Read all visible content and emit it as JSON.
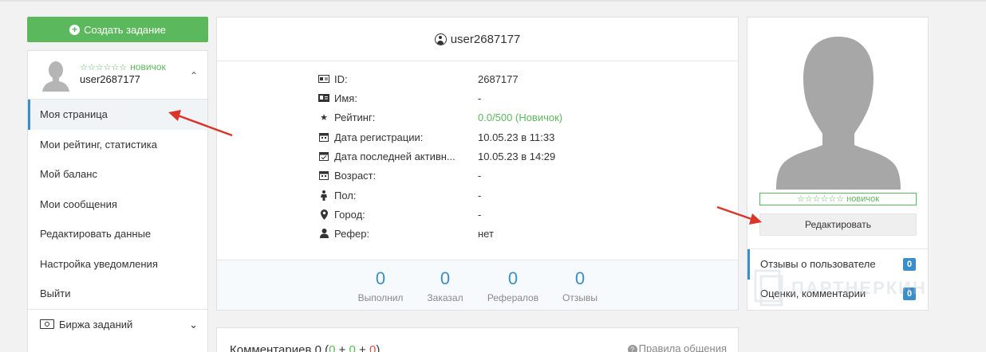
{
  "sidebar": {
    "create_button": "Создать задание",
    "user": {
      "stars": "☆☆☆☆☆☆",
      "rank": "новичок",
      "username": "user2687177"
    },
    "menu": [
      {
        "label": "Моя страница",
        "active": true
      },
      {
        "label": "Мои рейтинг, статистика"
      },
      {
        "label": "Мой баланс"
      },
      {
        "label": "Мои сообщения"
      },
      {
        "label": "Редактировать данные"
      },
      {
        "label": "Настройка уведомления"
      },
      {
        "label": "Выйти"
      }
    ],
    "birzha": "Биржа заданий"
  },
  "profile": {
    "title": "user2687177",
    "rows": [
      {
        "icon": "id-card-icon",
        "label": "ID:",
        "value": "2687177"
      },
      {
        "icon": "name-card-icon",
        "label": "Имя:",
        "value": "-"
      },
      {
        "icon": "star-icon",
        "label": "Рейтинг:",
        "value": "0.0/500 (Новичок)",
        "highlight": true
      },
      {
        "icon": "calendar-icon",
        "label": "Дата регистрации:",
        "value": "10.05.23 в 11:33"
      },
      {
        "icon": "calendar-check-icon",
        "label": "Дата последней активн...",
        "value": "10.05.23 в 14:29"
      },
      {
        "icon": "calendar-icon",
        "label": "Возраст:",
        "value": "-"
      },
      {
        "icon": "gender-icon",
        "label": "Пол:",
        "value": "-"
      },
      {
        "icon": "map-marker-icon",
        "label": "Город:",
        "value": "-"
      },
      {
        "icon": "user-icon",
        "label": "Рефер:",
        "value": "нет"
      }
    ],
    "stats": [
      {
        "value": "0",
        "label": "Выполнил"
      },
      {
        "value": "0",
        "label": "Заказал"
      },
      {
        "value": "0",
        "label": "Рефералов"
      },
      {
        "value": "0",
        "label": "Отзывы"
      }
    ]
  },
  "comments": {
    "title_prefix": "Комментариев 0 (",
    "pos": "0",
    "plus1": " + ",
    "neu": "0",
    "plus2": " + ",
    "neg": "0",
    "suffix": ")",
    "rules": "Правила общения"
  },
  "right": {
    "stars": "☆☆☆☆☆☆",
    "rank": "новичок",
    "edit_button": "Редактировать",
    "reviews_label": "Отзывы о пользователе",
    "reviews_count": "0",
    "ratings_label": "Оценки, комментарии",
    "ratings_count": "0"
  },
  "watermark": "ПАРТНЕРКИН",
  "colors": {
    "green": "#5cb85c",
    "blue": "#3a8ec9",
    "red": "#d9534f",
    "arrow": "#d9352b"
  }
}
